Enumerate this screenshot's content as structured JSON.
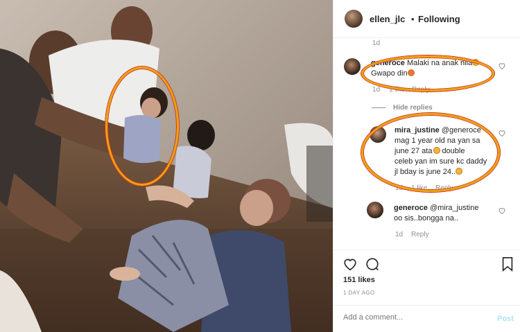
{
  "header": {
    "username": "ellen_jlc",
    "separator": "•",
    "follow_status": "Following"
  },
  "comments": {
    "first_time": "1d",
    "c1": {
      "user": "generoce",
      "text": "Malaki na anak nila",
      "text2": "Gwapo din",
      "time": "1d",
      "likes": "1 like",
      "reply": "Reply"
    },
    "hide_replies": "Hide replies",
    "r1": {
      "user": "mira_justine",
      "mention": "@generoce",
      "lines": [
        "mag 1 year old na yan sa",
        "june 27 ata",
        "double",
        "celeb yan im sure kc daddy",
        "jl bday is june 24.."
      ],
      "time": "1d",
      "likes": "1 like",
      "reply": "Reply"
    },
    "r2": {
      "user": "generoce",
      "mention": "@mira_justine",
      "line2": "oo sis..bongga na..",
      "time": "1d",
      "reply": "Reply"
    }
  },
  "actions": {
    "icons": [
      "heart-icon",
      "comment-icon",
      "bookmark-icon"
    ]
  },
  "likes": "151 likes",
  "date": "1 DAY AGO",
  "add_comment": {
    "placeholder": "Add a comment...",
    "post_label": "Post"
  },
  "colors": {
    "highlight_oval": "#e9a40f",
    "oval_edge": "#d6301e",
    "post_disabled": "#b2dffc",
    "muted": "#8e8e8e"
  }
}
